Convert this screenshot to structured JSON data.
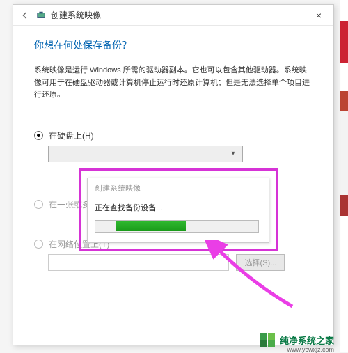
{
  "window": {
    "title": "创建系统映像",
    "close": "×"
  },
  "heading": "你想在何处保存备份？",
  "description": "系统映像是运行 Windows 所需的驱动器副本。它也可以包含其他驱动器。系统映像可用于在硬盘驱动器或计算机停止运行时还原计算机；但是无法选择单个项目进行还原。",
  "options": {
    "hdd": {
      "label": "在硬盘上(H)"
    },
    "dvd": {
      "label": "在一张或多张 DVD 上(D)"
    },
    "net": {
      "label": "在网络位置上(T)",
      "browse": "选择(S)..."
    }
  },
  "dialog": {
    "title": "创建系统映像",
    "message": "正在查找备份设备..."
  },
  "watermark": {
    "name": "纯净系统之家",
    "url": "www.ycwxjz.com"
  },
  "colors": {
    "highlight": "#d633d6",
    "arrow": "#ea3ee6",
    "heading": "#0063b1",
    "progress": "#1a9a1a"
  }
}
